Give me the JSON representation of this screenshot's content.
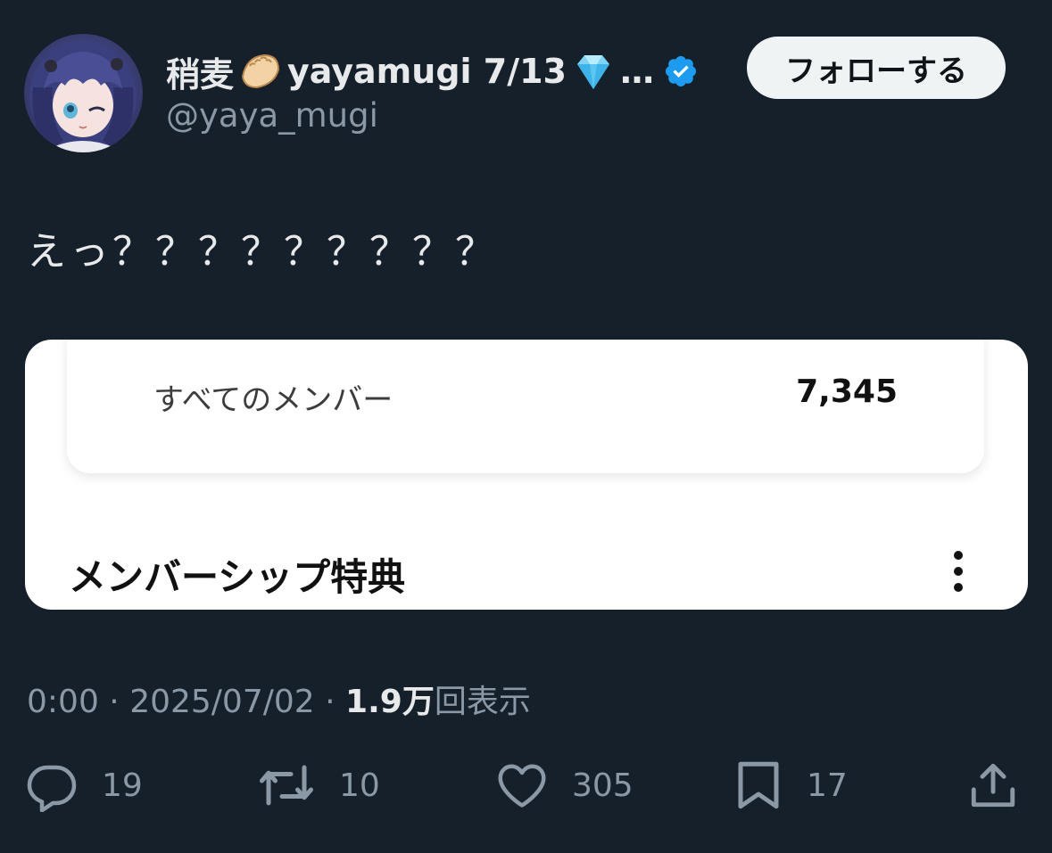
{
  "user": {
    "display_name": "稍麦🥟yayamugi 7/13💎…",
    "name_text": "稍麦",
    "name_suffix": "yayamugi 7/13",
    "ellipsis": "…",
    "handle": "@yaya_mugi",
    "verified": true,
    "follow_label": "フォローする"
  },
  "tweet": {
    "text": "えっ？？？？？？？？？"
  },
  "media": {
    "members_label": "すべてのメンバー",
    "members_count": "7,345",
    "perks_title": "メンバーシップ特典"
  },
  "meta": {
    "time": "0:00",
    "date": "2025/07/02",
    "views_number": "1.9",
    "views_unit": "万",
    "views_suffix": "回表示"
  },
  "actions": {
    "reply_count": "19",
    "retweet_count": "10",
    "like_count": "305",
    "bookmark_count": "17"
  },
  "icons": [
    "reply-icon",
    "retweet-icon",
    "like-icon",
    "bookmark-icon",
    "share-icon",
    "verified-badge-icon",
    "dumpling-emoji-icon",
    "gem-emoji-icon",
    "more-options-icon"
  ],
  "colors": {
    "background": "#15202b",
    "verified": "#1d9bf0",
    "secondary_text": "#8b98a5",
    "primary_text": "#e7e9ea",
    "follow_button": "#eff3f4"
  }
}
